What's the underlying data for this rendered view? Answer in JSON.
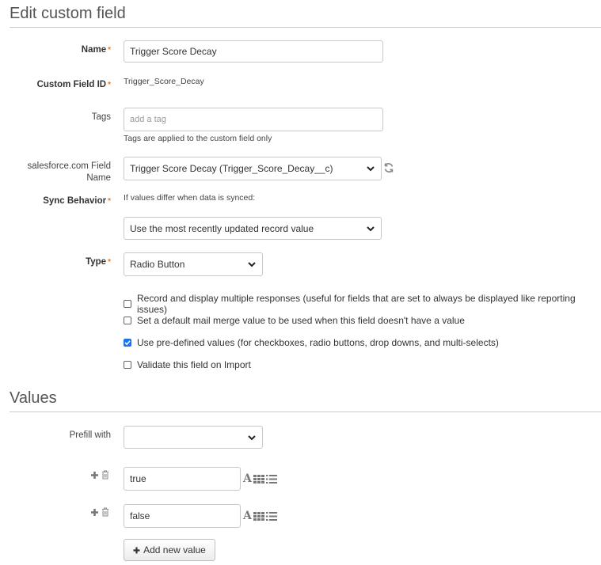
{
  "header": {
    "title": "Edit custom field"
  },
  "form": {
    "name": {
      "label": "Name",
      "required_mark": "*",
      "value": "Trigger Score Decay"
    },
    "custom_field_id": {
      "label": "Custom Field ID",
      "required_mark": "*",
      "value": "Trigger_Score_Decay"
    },
    "tags": {
      "label": "Tags",
      "placeholder": "add a tag",
      "help": "Tags are applied to the custom field only"
    },
    "salesforce_field": {
      "label_line1": "salesforce.com Field",
      "label_line2": "Name",
      "selected": "Trigger Score Decay (Trigger_Score_Decay__c)",
      "refresh_icon": "refresh-icon"
    },
    "sync_behavior": {
      "label": "Sync Behavior",
      "required_mark": "*",
      "help": "If values differ when data is synced:",
      "selected": "Use the most recently updated record value"
    },
    "type": {
      "label": "Type",
      "required_mark": "*",
      "selected": "Radio Button"
    },
    "options": [
      {
        "label": "Record and display multiple responses (useful for fields that are set to always be displayed like reporting issues)",
        "checked": false
      },
      {
        "label": "Set a default mail merge value to be used when this field doesn't have a value",
        "checked": false
      },
      {
        "label": "Use pre-defined values (for checkboxes, radio buttons, drop downs, and multi-selects)",
        "checked": true
      },
      {
        "label": "Validate this field on Import",
        "checked": false
      }
    ]
  },
  "values_section": {
    "title": "Values",
    "prefill": {
      "label": "Prefill with",
      "selected": ""
    },
    "values": [
      {
        "value": "true"
      },
      {
        "value": "false"
      }
    ],
    "add_button": {
      "label": "Add new value",
      "icon": "plus-icon"
    }
  },
  "colors": {
    "required_mark": "#e07b24",
    "checkbox_checked": "#1a73e8",
    "rule": "#cccccc",
    "icon": "#777777"
  }
}
